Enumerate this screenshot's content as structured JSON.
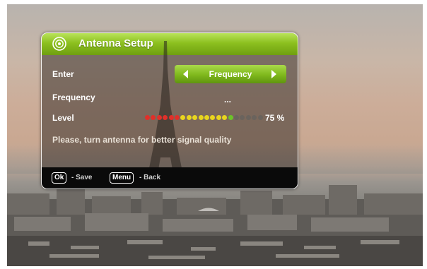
{
  "dialog": {
    "title": "Antenna Setup",
    "title_icon": "antenna-setup-icon"
  },
  "rows": {
    "enter_label": "Enter",
    "enter_value": "Frequency",
    "frequency_label": "Frequency",
    "frequency_value": "...",
    "level_label": "Level",
    "level_percent_text": "75 %",
    "level_fraction": 0.75
  },
  "hint": "Please, turn antenna for better signal quality",
  "footer": {
    "ok_key": "Ok",
    "ok_desc": "- Save",
    "menu_key": "Menu",
    "menu_desc": "- Back"
  },
  "colors": {
    "accent_green": "#8cc01f",
    "level_red": "#e0302a",
    "level_yellow": "#e8d51e",
    "level_green": "#6cc32a",
    "level_off": "#6a635d"
  }
}
